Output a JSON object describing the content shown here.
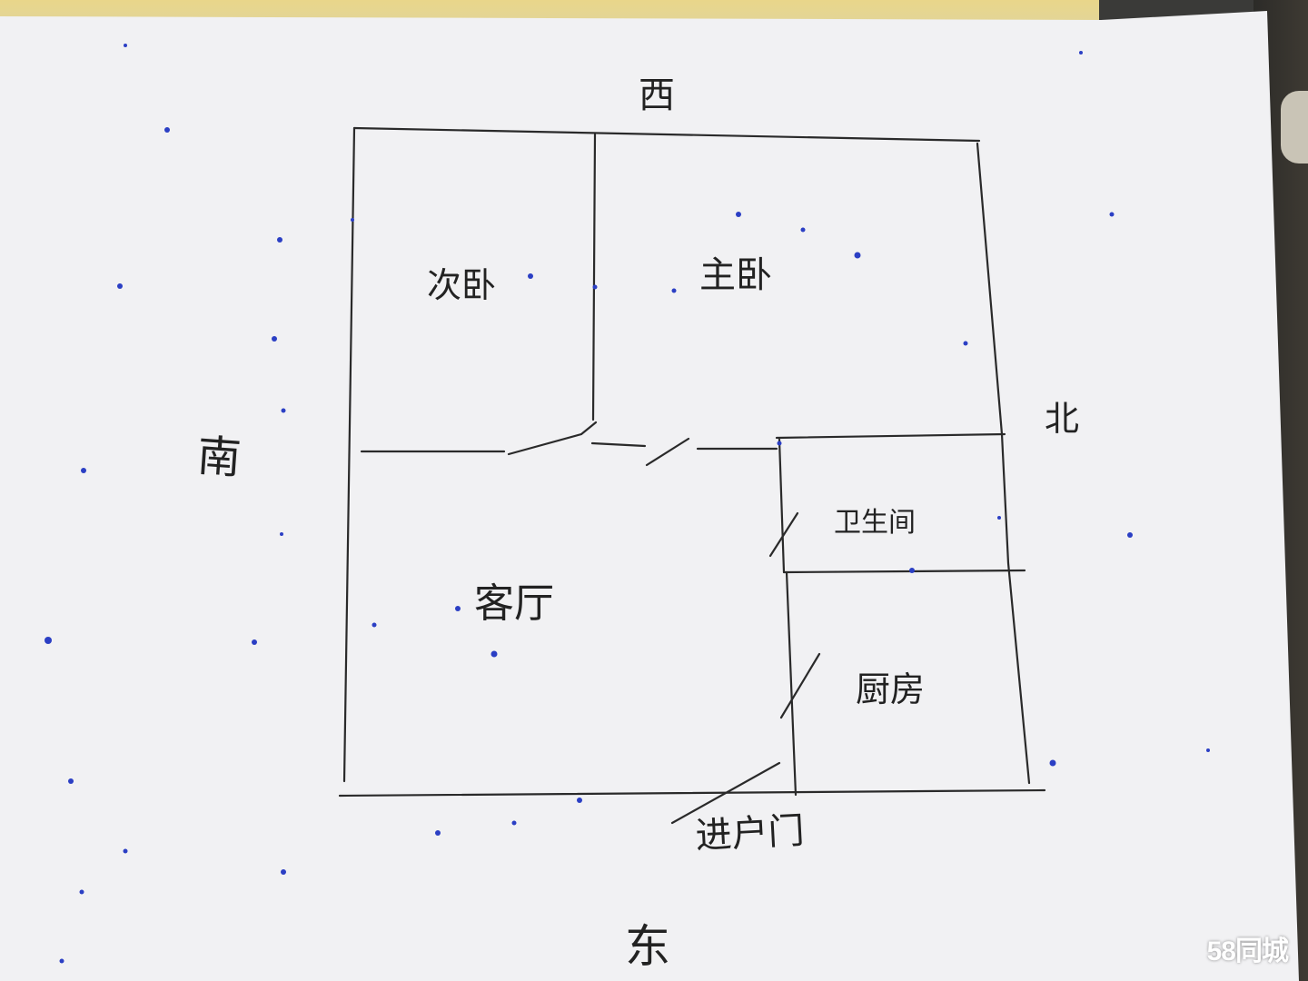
{
  "compass": {
    "top": "西",
    "left": "南",
    "right": "北",
    "bottom": "东"
  },
  "rooms": {
    "second_bedroom": "次卧",
    "master_bedroom": "主卧",
    "bathroom": "卫生间",
    "living_room": "客厅",
    "kitchen": "厨房",
    "entrance": "进户门"
  },
  "watermark": {
    "number": "58",
    "brand": "同城"
  },
  "colors": {
    "paper": "#f1f1f3",
    "ink": "#2a2a2a",
    "dot": "#2b3fc4"
  }
}
